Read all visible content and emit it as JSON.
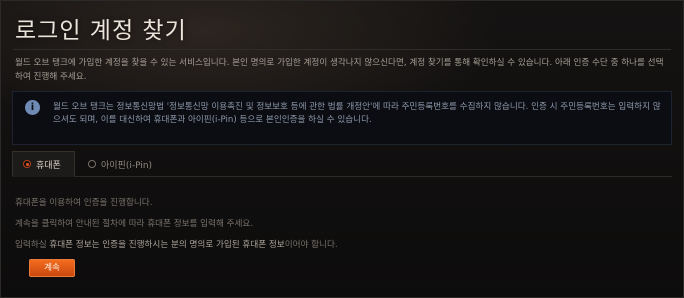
{
  "page": {
    "title": "로그인 계정 찾기",
    "intro": "월드 오브 탱크에 가입한 계정을 찾을 수 있는 서비스입니다. 본인 명의로 가입한 계정이 생각나지 않으신다면, 계정 찾기를 통해 확인하실 수 있습니다. 아래 인증 수단 중 하나를 선택하여 진행해 주세요."
  },
  "info": {
    "icon": "info-icon",
    "text": "월드 오브 탱크는 정보통신망법 '정보통신망 이용촉진 및 정보보호 등에 관한 법률 개정안'에 따라 주민등록번호를 수집하지 않습니다. 인증 시 주민등록번호는 입력하지 않으셔도 되며, 이를 대신하여 휴대폰과 아이핀(i-Pin) 등으로 본인인증을 하실 수 있습니다."
  },
  "tabs": [
    {
      "label": "휴대폰",
      "selected": true
    },
    {
      "label": "아이핀(i-Pin)",
      "selected": false
    }
  ],
  "instructions": {
    "line1": "휴대폰을 이용하여 인증을 진행합니다.",
    "line2": "계속을 클릭하여 안내된 절차에 따라 휴대폰 정보를 입력해 주세요.",
    "line3_prefix": "입력하실 ",
    "line3_highlight": "휴대폰 정보는 인증을 진행하시는 분의 명의로 가입된 휴대폰 정보",
    "line3_suffix": "이어야 합니다."
  },
  "button": {
    "continue_label": "계속"
  },
  "colors": {
    "accent": "#e8621d",
    "background": "#0a0909",
    "info_icon": "#6f8bb5"
  }
}
